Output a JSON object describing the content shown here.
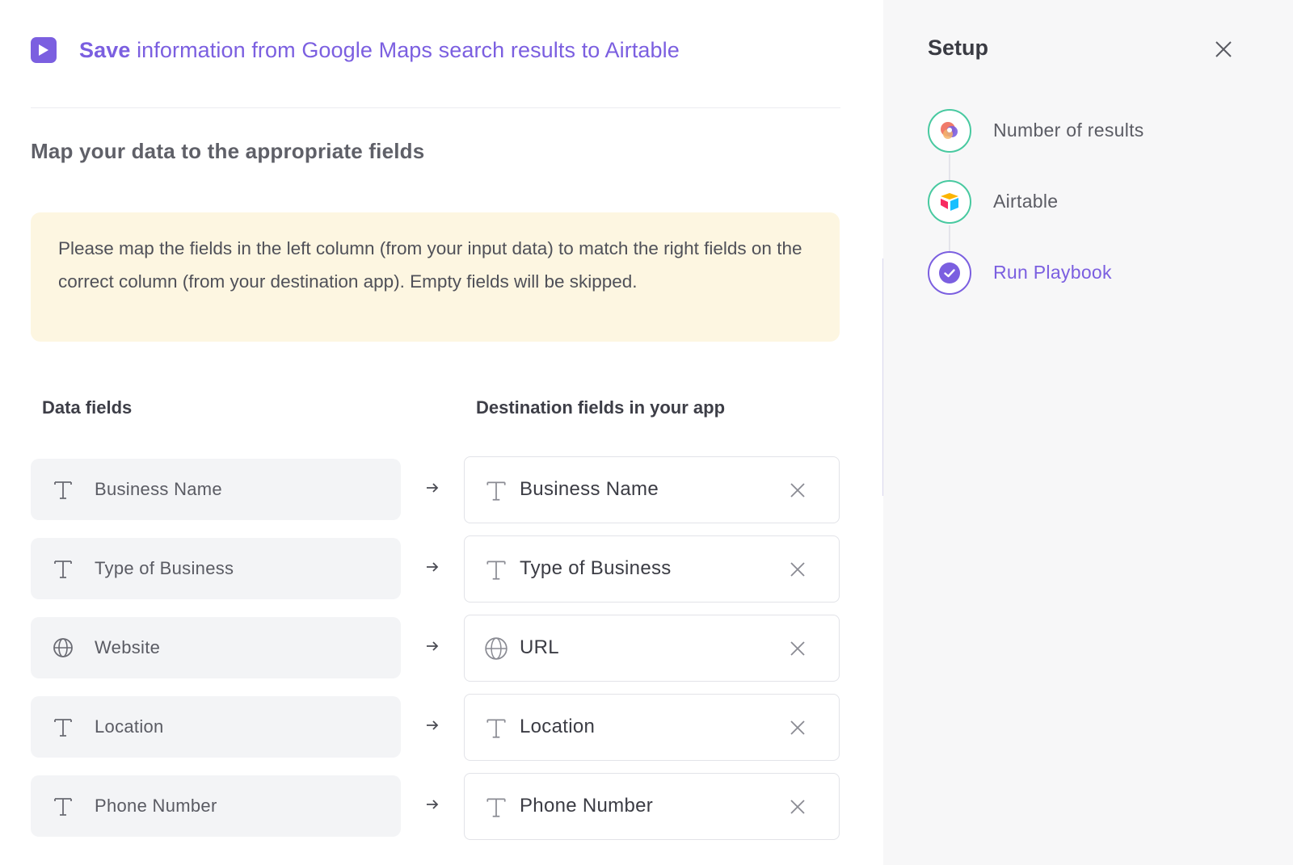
{
  "header": {
    "title_strong": "Save",
    "title_rest": " information from Google Maps search results to Airtable"
  },
  "section_title": "Map your data to the appropriate fields",
  "notice": "Please map the fields in the left column (from your input data) to match the right fields on the correct column (from your destination app). Empty fields will be skipped.",
  "columns": {
    "left": "Data fields",
    "right": "Destination fields in your app"
  },
  "mappings": [
    {
      "source": "Business Name",
      "source_icon": "text-type-icon",
      "destination": "Business Name",
      "destination_icon": "text-type-icon"
    },
    {
      "source": "Type of Business",
      "source_icon": "text-type-icon",
      "destination": "Type of Business",
      "destination_icon": "text-type-icon"
    },
    {
      "source": "Website",
      "source_icon": "globe-icon",
      "destination": "URL",
      "destination_icon": "globe-icon"
    },
    {
      "source": "Location",
      "source_icon": "text-type-icon",
      "destination": "Location",
      "destination_icon": "text-type-icon"
    },
    {
      "source": "Phone Number",
      "source_icon": "text-type-icon",
      "destination": "Phone Number",
      "destination_icon": "text-type-icon"
    }
  ],
  "setup": {
    "title": "Setup",
    "steps": [
      {
        "label": "Number of results",
        "icon": "app-logo-icon",
        "state": "done"
      },
      {
        "label": "Airtable",
        "icon": "airtable-logo-icon",
        "state": "done"
      },
      {
        "label": "Run Playbook",
        "icon": "check-circle-icon",
        "state": "active"
      }
    ]
  },
  "colors": {
    "accent": "#7b5fe0",
    "success": "#48c9a0",
    "notice_bg": "#fdf6e1",
    "field_bg": "#f3f4f6",
    "panel_bg": "#f7f7f8"
  }
}
